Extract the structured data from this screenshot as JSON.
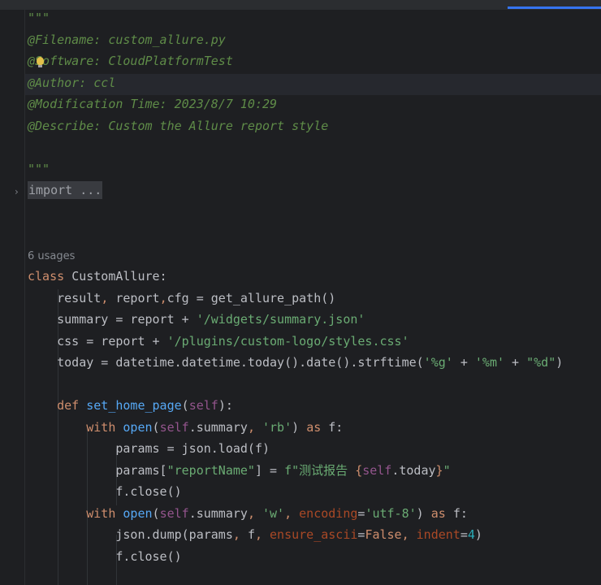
{
  "editor": {
    "code_lines": [
      {
        "parts": [
          {
            "t": "\"\"\"",
            "c": "doc"
          }
        ]
      },
      {
        "parts": [
          {
            "t": "@Filename: custom_allure.py",
            "c": "doc"
          }
        ]
      },
      {
        "parts": [
          {
            "t": "@Software: CloudPlatformTest",
            "c": "doc"
          }
        ]
      },
      {
        "parts": [
          {
            "t": "@Author: ccl",
            "c": "doc"
          }
        ]
      },
      {
        "parts": [
          {
            "t": "@Modification Time: 2023/8/7 10:29",
            "c": "doc"
          }
        ]
      },
      {
        "parts": [
          {
            "t": "@Describe: Custom the Allure report style",
            "c": "doc"
          }
        ]
      },
      {
        "parts": []
      },
      {
        "parts": [
          {
            "t": "\"\"\"",
            "c": "doc"
          }
        ]
      },
      {
        "parts": [
          {
            "t": "import ...",
            "c": "folded"
          }
        ]
      },
      {
        "parts": []
      },
      {
        "parts": []
      },
      {
        "parts": [
          {
            "t": "6 usages",
            "c": "usages"
          }
        ]
      },
      {
        "parts": [
          {
            "t": "class ",
            "c": "kw"
          },
          {
            "t": "CustomAllure:",
            "c": ""
          }
        ]
      },
      {
        "parts": [
          {
            "t": "    result",
            "c": ""
          },
          {
            "t": ", ",
            "c": "kw"
          },
          {
            "t": "report",
            "c": ""
          },
          {
            "t": ",",
            "c": "kw"
          },
          {
            "t": "cfg = get_allure_path()",
            "c": ""
          }
        ]
      },
      {
        "parts": [
          {
            "t": "    summary = report + ",
            "c": ""
          },
          {
            "t": "'/widgets/summary.json'",
            "c": "str"
          }
        ]
      },
      {
        "parts": [
          {
            "t": "    css = report + ",
            "c": ""
          },
          {
            "t": "'/plugins/custom-logo/styles.css'",
            "c": "str"
          }
        ]
      },
      {
        "parts": [
          {
            "t": "    today = datetime.datetime.today().date().strftime(",
            "c": ""
          },
          {
            "t": "'%g'",
            "c": "str"
          },
          {
            "t": " + ",
            "c": ""
          },
          {
            "t": "'%m'",
            "c": "str"
          },
          {
            "t": " + ",
            "c": ""
          },
          {
            "t": "\"%d\"",
            "c": "str"
          },
          {
            "t": ")",
            "c": ""
          }
        ]
      },
      {
        "parts": []
      },
      {
        "parts": [
          {
            "t": "    ",
            "c": ""
          },
          {
            "t": "def ",
            "c": "kw"
          },
          {
            "t": "set_home_page",
            "c": "fn"
          },
          {
            "t": "(",
            "c": ""
          },
          {
            "t": "self",
            "c": "self"
          },
          {
            "t": "):",
            "c": ""
          }
        ]
      },
      {
        "parts": [
          {
            "t": "        ",
            "c": ""
          },
          {
            "t": "with ",
            "c": "kw"
          },
          {
            "t": "open",
            "c": "fn"
          },
          {
            "t": "(",
            "c": ""
          },
          {
            "t": "self",
            "c": "self"
          },
          {
            "t": ".summary",
            "c": ""
          },
          {
            "t": ", ",
            "c": "kw"
          },
          {
            "t": "'rb'",
            "c": "str"
          },
          {
            "t": ") ",
            "c": ""
          },
          {
            "t": "as ",
            "c": "kw"
          },
          {
            "t": "f:",
            "c": ""
          }
        ]
      },
      {
        "parts": [
          {
            "t": "            params = json.load(f)",
            "c": ""
          }
        ]
      },
      {
        "parts": [
          {
            "t": "            params[",
            "c": ""
          },
          {
            "t": "\"reportName\"",
            "c": "str"
          },
          {
            "t": "] = ",
            "c": ""
          },
          {
            "t": "f\"测试报告 ",
            "c": "str"
          },
          {
            "t": "{",
            "c": "kw"
          },
          {
            "t": "self",
            "c": "self"
          },
          {
            "t": ".today",
            "c": ""
          },
          {
            "t": "}",
            "c": "kw"
          },
          {
            "t": "\"",
            "c": "str"
          }
        ]
      },
      {
        "parts": [
          {
            "t": "            f.close()",
            "c": ""
          }
        ]
      },
      {
        "parts": [
          {
            "t": "        ",
            "c": ""
          },
          {
            "t": "with ",
            "c": "kw"
          },
          {
            "t": "open",
            "c": "fn"
          },
          {
            "t": "(",
            "c": ""
          },
          {
            "t": "self",
            "c": "self"
          },
          {
            "t": ".summary",
            "c": ""
          },
          {
            "t": ", ",
            "c": "kw"
          },
          {
            "t": "'w'",
            "c": "str"
          },
          {
            "t": ", ",
            "c": "kw"
          },
          {
            "t": "encoding",
            "c": "param"
          },
          {
            "t": "=",
            "c": ""
          },
          {
            "t": "'utf-8'",
            "c": "str"
          },
          {
            "t": ") ",
            "c": ""
          },
          {
            "t": "as ",
            "c": "kw"
          },
          {
            "t": "f:",
            "c": ""
          }
        ]
      },
      {
        "parts": [
          {
            "t": "            json.dump(params",
            "c": ""
          },
          {
            "t": ", ",
            "c": "kw"
          },
          {
            "t": "f",
            "c": ""
          },
          {
            "t": ", ",
            "c": "kw"
          },
          {
            "t": "ensure_ascii",
            "c": "param"
          },
          {
            "t": "=",
            "c": ""
          },
          {
            "t": "False",
            "c": "kw"
          },
          {
            "t": ", ",
            "c": "kw"
          },
          {
            "t": "indent",
            "c": "param"
          },
          {
            "t": "=",
            "c": ""
          },
          {
            "t": "4",
            "c": "num"
          },
          {
            "t": ")",
            "c": ""
          }
        ]
      },
      {
        "parts": [
          {
            "t": "            f.close()",
            "c": ""
          }
        ]
      }
    ],
    "colors": {
      "background": "#1e1f22",
      "docstring": "#5f8c48",
      "keyword": "#cf8e6d",
      "string": "#6aab73",
      "function": "#56a8f5",
      "self": "#94558d",
      "number": "#2aacb8",
      "named_param": "#aa4926",
      "text": "#bcbec4"
    },
    "icons": [
      "fold-arrow-icon",
      "lightbulb-icon"
    ]
  }
}
